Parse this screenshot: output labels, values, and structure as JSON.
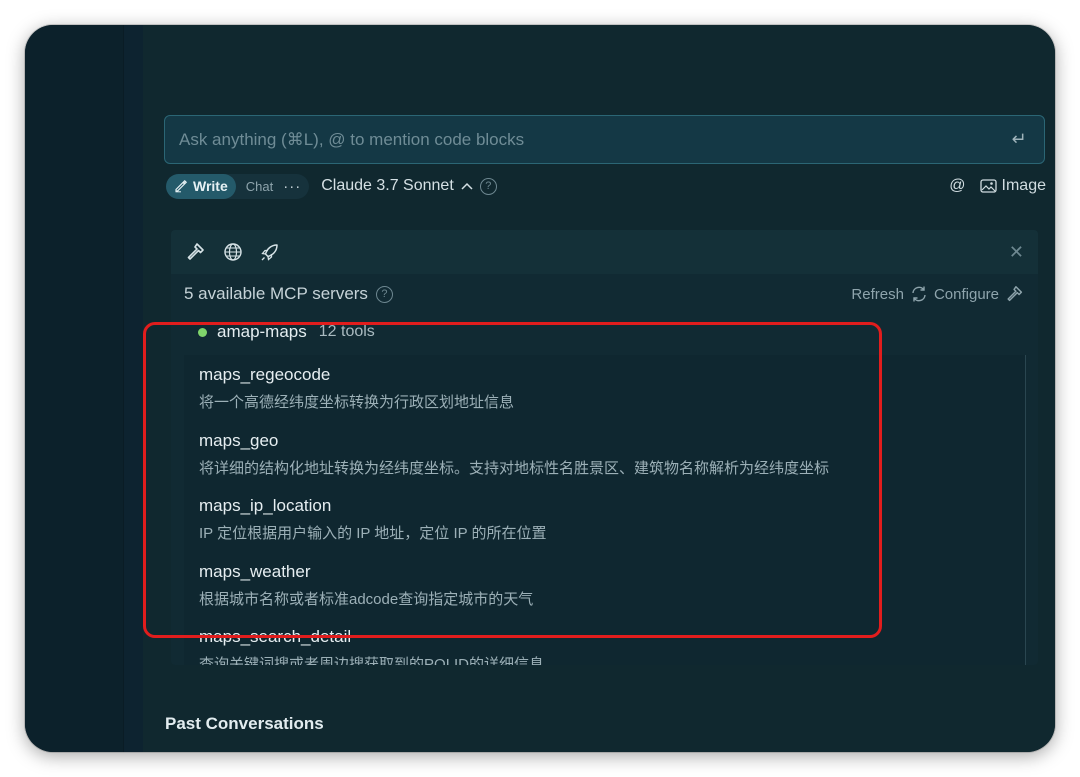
{
  "input": {
    "placeholder": "Ask anything (⌘L), @ to mention code blocks"
  },
  "toolbar": {
    "write_label": "Write",
    "chat_label": "Chat",
    "more_label": "···",
    "model_label": "Claude 3.7 Sonnet",
    "mention_label": "@",
    "image_label": "Image"
  },
  "mcp": {
    "servers_label": "5 available MCP servers",
    "refresh_label": "Refresh",
    "configure_label": "Configure",
    "server": {
      "name": "amap-maps",
      "tools_count": "12 tools",
      "status_color": "#7fd46b"
    },
    "tools": [
      {
        "name": "maps_regeocode",
        "desc": "将一个高德经纬度坐标转换为行政区划地址信息"
      },
      {
        "name": "maps_geo",
        "desc": "将详细的结构化地址转换为经纬度坐标。支持对地标性名胜景区、建筑物名称解析为经纬度坐标"
      },
      {
        "name": "maps_ip_location",
        "desc": "IP 定位根据用户输入的 IP 地址，定位 IP 的所在位置"
      },
      {
        "name": "maps_weather",
        "desc": "根据城市名称或者标准adcode查询指定城市的天气"
      },
      {
        "name": "maps_search_detail",
        "desc": "查询关键词搜或者周边搜获取到的POI ID的详细信息"
      }
    ]
  },
  "past": {
    "title": "Past Conversations"
  },
  "colors": {
    "highlight": "#e11d1d",
    "accent": "#245a6a"
  }
}
